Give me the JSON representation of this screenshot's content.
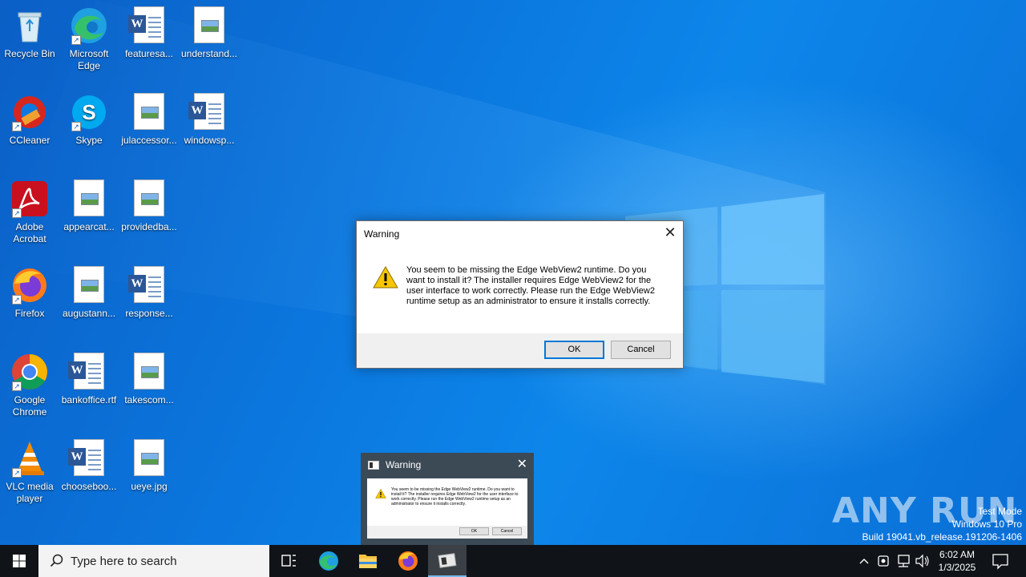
{
  "desktop": {
    "icons": [
      {
        "label": "Recycle Bin",
        "icon": "recycle-bin-icon"
      },
      {
        "label": "Microsoft Edge",
        "icon": "edge-icon"
      },
      {
        "label": "featuresa...",
        "icon": "word-doc-icon"
      },
      {
        "label": "understand...",
        "icon": "image-file-icon"
      },
      {
        "label": "CCleaner",
        "icon": "ccleaner-icon"
      },
      {
        "label": "Skype",
        "icon": "skype-icon"
      },
      {
        "label": "julaccessor...",
        "icon": "image-file-icon"
      },
      {
        "label": "windowsp...",
        "icon": "word-doc-icon"
      },
      {
        "label": "Adobe Acrobat",
        "icon": "acrobat-icon"
      },
      {
        "label": "appearcat...",
        "icon": "image-file-icon"
      },
      {
        "label": "providedba...",
        "icon": "image-file-icon"
      },
      {
        "label": "Firefox",
        "icon": "firefox-icon"
      },
      {
        "label": "augustann...",
        "icon": "image-file-icon"
      },
      {
        "label": "response...",
        "icon": "word-doc-icon"
      },
      {
        "label": "Google Chrome",
        "icon": "chrome-icon"
      },
      {
        "label": "bankoffice.rtf",
        "icon": "word-doc-icon"
      },
      {
        "label": "takescom...",
        "icon": "image-file-icon"
      },
      {
        "label": "VLC media player",
        "icon": "vlc-icon"
      },
      {
        "label": "chooseboo...",
        "icon": "word-doc-icon"
      },
      {
        "label": "ueye.jpg",
        "icon": "image-file-icon"
      }
    ]
  },
  "dialog": {
    "title": "Warning",
    "message": "You seem to be missing the Edge WebView2 runtime. Do you want to install it? The installer requires Edge WebView2 for the user interface to work correctly. Please run the Edge WebView2 runtime setup as an administrator to ensure it installs correctly.",
    "ok_label": "OK",
    "cancel_label": "Cancel"
  },
  "thumbnail": {
    "title": "Warning",
    "message": "You seem to be missing the Edge WebView2 runtime. Do you want to install it? The installer requires Edge WebView2 for the user interface to work correctly. Please run the Edge WebView2 runtime setup as an administrator to ensure it installs correctly.",
    "ok_label": "OK",
    "cancel_label": "Cancel"
  },
  "watermark": {
    "brand": "ANY RUN",
    "line1": "Test Mode",
    "line2": "Windows 10 Pro",
    "line3": "Build 19041.vb_release.191206-1406"
  },
  "taskbar": {
    "search_placeholder": "Type here to search",
    "time": "6:02 AM",
    "date": "1/3/2025"
  }
}
